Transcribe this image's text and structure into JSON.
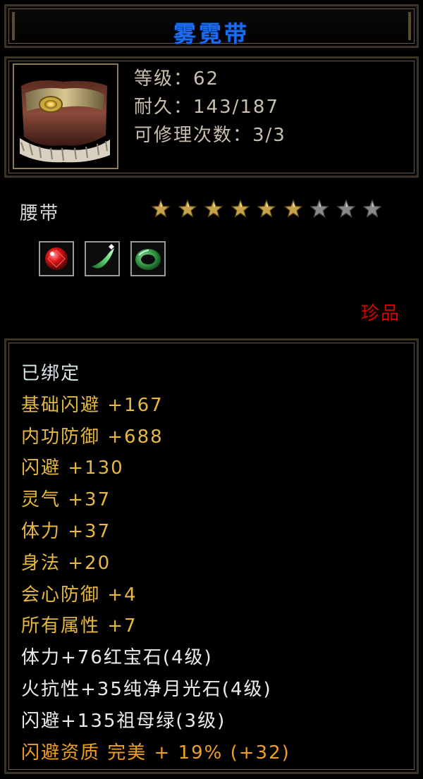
{
  "item": {
    "name": "雾霓带",
    "info_lines": [
      "等级：62",
      "耐久：143/187",
      "可修理次数：3/3"
    ],
    "type": "腰带",
    "stars": {
      "total": 9,
      "filled": 6
    },
    "gems": [
      {
        "icon": "red-gem-icon",
        "color": "#d01818"
      },
      {
        "icon": "green-crescent-gem-icon",
        "color": "#4fd06a"
      },
      {
        "icon": "jade-ring-icon",
        "color": "#2c8a3c"
      }
    ],
    "rarity": "珍品"
  },
  "attributes": [
    {
      "text": "已绑定",
      "style": "bound"
    },
    {
      "text": "基础闪避 +167",
      "style": "gold"
    },
    {
      "text": "内功防御 +688",
      "style": "gold"
    },
    {
      "text": "闪避 +130",
      "style": "gold"
    },
    {
      "text": "灵气 +37",
      "style": "gold"
    },
    {
      "text": "体力 +37",
      "style": "gold"
    },
    {
      "text": "身法 +20",
      "style": "gold"
    },
    {
      "text": "会心防御 +4",
      "style": "gold"
    },
    {
      "text": "所有属性 +7",
      "style": "gold"
    },
    {
      "text": "体力+76红宝石(4级)",
      "style": "white"
    },
    {
      "text": "火抗性+35纯净月光石(4级)",
      "style": "white"
    },
    {
      "text": "闪避+135祖母绿(3级)",
      "style": "white"
    },
    {
      "text": "闪避资质 完美 + 19% (+32)",
      "style": "orange"
    }
  ],
  "colors": {
    "title": "#1b6cf0",
    "rarity": "#e00000",
    "gold_text": "#e6b840",
    "white_text": "#ececec",
    "orange_text": "#f0a020",
    "border": "#6b5c40"
  }
}
